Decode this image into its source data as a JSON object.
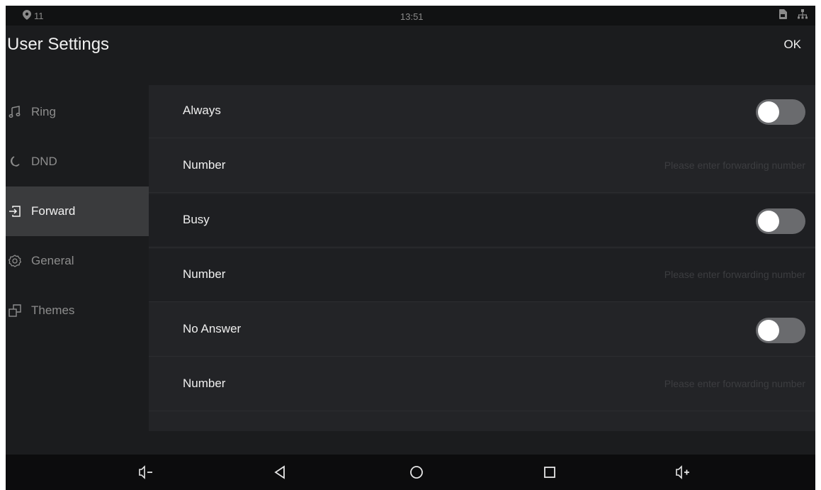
{
  "statusbar": {
    "notification_count": "11",
    "time": "13:51"
  },
  "header": {
    "title": "User Settings",
    "ok_label": "OK"
  },
  "sidebar": {
    "items": [
      {
        "label": "Ring",
        "icon": "music-note-icon"
      },
      {
        "label": "DND",
        "icon": "moon-icon"
      },
      {
        "label": "Forward",
        "icon": "forward-icon",
        "active": true
      },
      {
        "label": "General",
        "icon": "gear-icon"
      },
      {
        "label": "Themes",
        "icon": "themes-icon"
      }
    ]
  },
  "forward": {
    "always": {
      "label": "Always",
      "enabled": false
    },
    "always_number": {
      "label": "Number",
      "placeholder": "Please enter forwarding number"
    },
    "busy": {
      "label": "Busy",
      "enabled": false
    },
    "busy_number": {
      "label": "Number",
      "placeholder": "Please enter forwarding number"
    },
    "no_answer": {
      "label": "No Answer",
      "enabled": false
    },
    "no_answer_number": {
      "label": "Number",
      "placeholder": "Please enter forwarding number"
    }
  },
  "navbar": {
    "buttons": [
      "volume-down-icon",
      "back-icon",
      "home-icon",
      "recents-icon",
      "volume-up-icon"
    ]
  }
}
